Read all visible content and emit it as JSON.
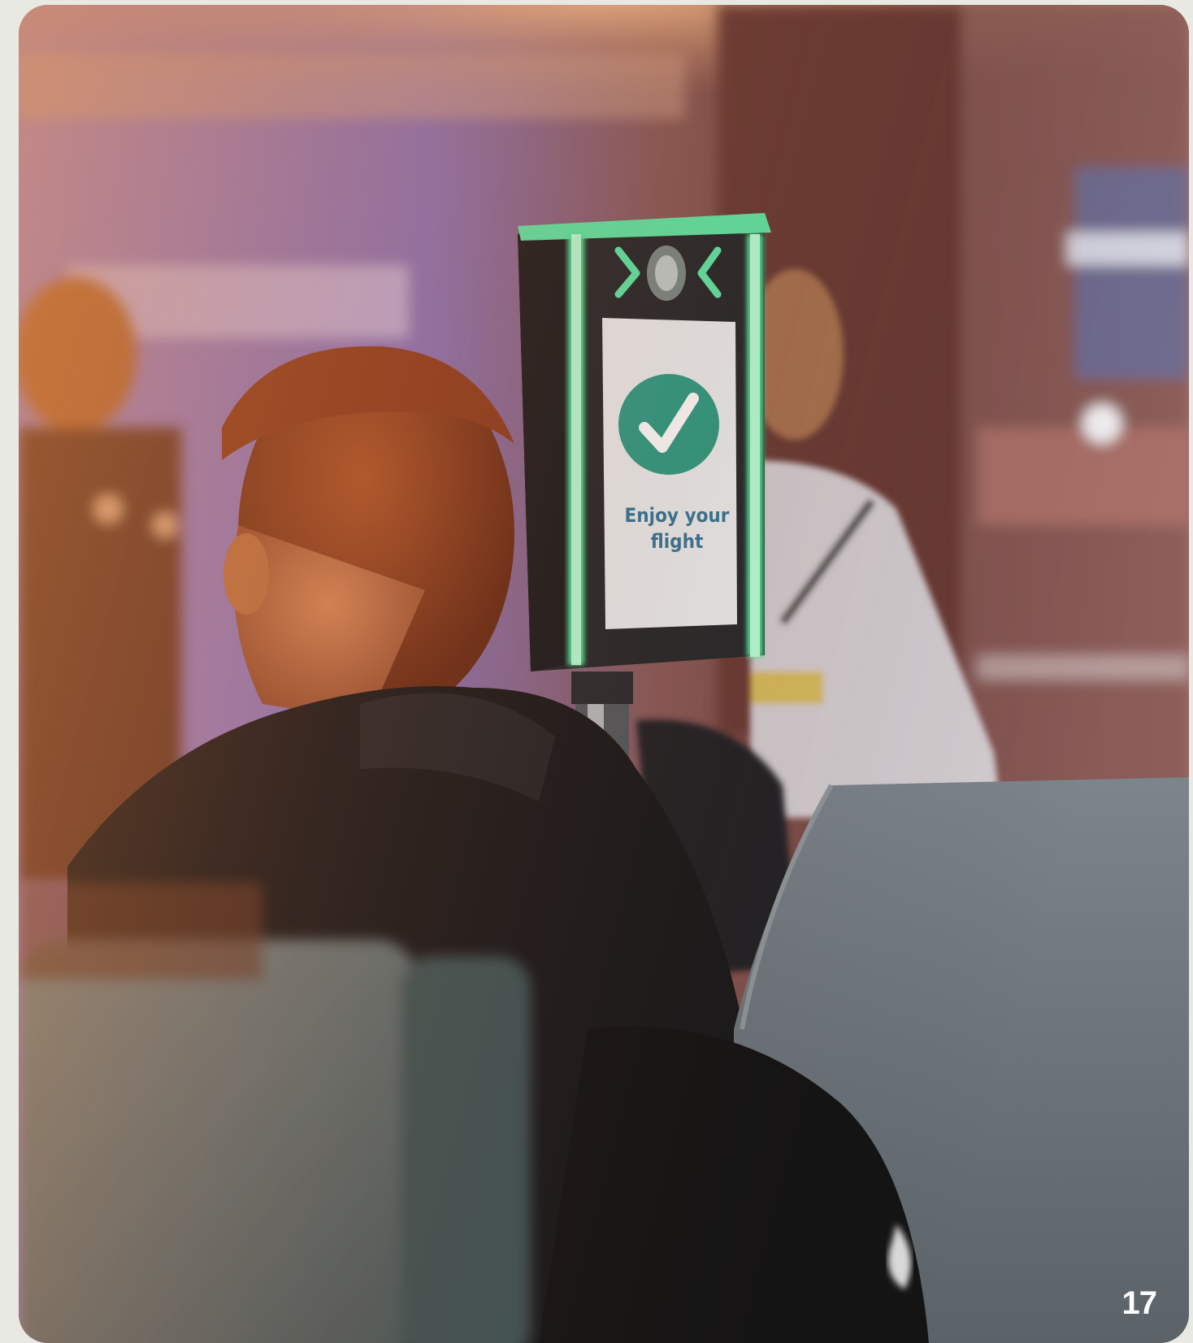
{
  "kiosk": {
    "screen_message": "Enjoy your flight",
    "status_color": "#2f9c84",
    "light_color": "#4fe89a"
  },
  "page": {
    "number": "17"
  }
}
